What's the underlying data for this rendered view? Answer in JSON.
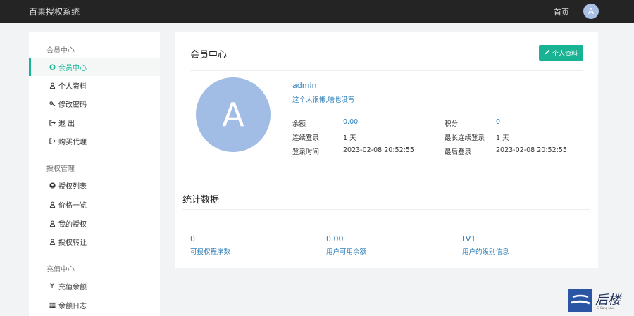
{
  "header": {
    "brand": "百果授权系统",
    "home_link": "首页",
    "avatar_letter": "A"
  },
  "sidebar": {
    "groups": [
      {
        "title": "会员中心",
        "items": [
          {
            "label": "会员中心",
            "icon": "user-circle-icon"
          },
          {
            "label": "个人资料",
            "icon": "user-icon"
          },
          {
            "label": "修改密码",
            "icon": "key-icon"
          },
          {
            "label": "退 出",
            "icon": "sign-out-icon"
          },
          {
            "label": "购买代理",
            "icon": "sign-out-icon"
          }
        ]
      },
      {
        "title": "授权管理",
        "items": [
          {
            "label": "授权列表",
            "icon": "user-circle-icon"
          },
          {
            "label": "价格一览",
            "icon": "user-icon"
          },
          {
            "label": "我的授权",
            "icon": "user-icon"
          },
          {
            "label": "授权转让",
            "icon": "user-icon"
          }
        ]
      },
      {
        "title": "充值中心",
        "items": [
          {
            "label": "充值余额",
            "icon": "yen-icon"
          },
          {
            "label": "余额日志",
            "icon": "list-icon"
          }
        ]
      }
    ]
  },
  "member": {
    "title": "会员中心",
    "profile_button": "个人资料",
    "avatar_letter": "A",
    "username": "admin",
    "bio": "这个人很懒,啥也没写",
    "fields": {
      "balance_label": "余额",
      "balance_value": "0.00",
      "points_label": "积分",
      "points_value": "0",
      "streak_label": "连续登录",
      "streak_value": "1 天",
      "longest_label": "最长连续登录",
      "longest_value": "1 天",
      "login_time_label": "登录时间",
      "login_time_value": "2023-02-08 20:52:55",
      "last_login_label": "最后登录",
      "last_login_value": "2023-02-08 20:52:55"
    }
  },
  "stats": {
    "title": "统计数据",
    "items": [
      {
        "value": "0",
        "label": "可授权程序数"
      },
      {
        "value": "0.00",
        "label": "用户可用余额"
      },
      {
        "value": "LV1",
        "label": "用户的级别信息"
      }
    ]
  },
  "watermark": {
    "text": "后楼",
    "sub": "Ei Cang Lou"
  }
}
